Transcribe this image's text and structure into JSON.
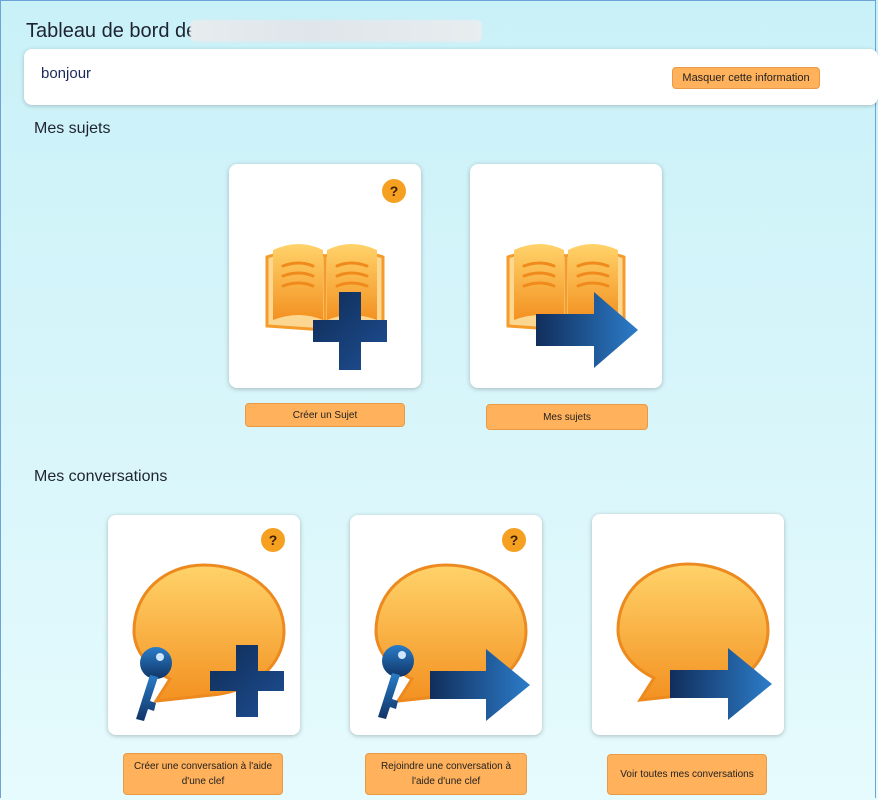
{
  "header": {
    "title": "Tableau de bord de"
  },
  "info": {
    "text": "bonjour",
    "hide_label": "Masquer cette information"
  },
  "sections": {
    "subjects": {
      "title": "Mes sujets",
      "tiles": [
        {
          "label": "Créer un Sujet",
          "help": "?"
        },
        {
          "label": "Mes sujets"
        }
      ]
    },
    "conversations": {
      "title": "Mes conversations",
      "tiles": [
        {
          "label": "Créer une conversation à l'aide d'une clef",
          "help": "?"
        },
        {
          "label": "Rejoindre une conversation à l'aide d'une clef",
          "help": "?"
        },
        {
          "label": "Voir toutes mes conversations"
        }
      ]
    }
  },
  "colors": {
    "accent": "#ffb15b",
    "icon_orange": "#f7a12c",
    "icon_navy": "#173a6e",
    "help_badge": "#f5a020"
  },
  "icons": {
    "create_subject": "book-plus-icon",
    "my_subjects": "book-arrow-icon",
    "create_conversation": "speech-key-plus-icon",
    "join_conversation": "speech-key-arrow-icon",
    "all_conversations": "speech-arrow-icon"
  }
}
